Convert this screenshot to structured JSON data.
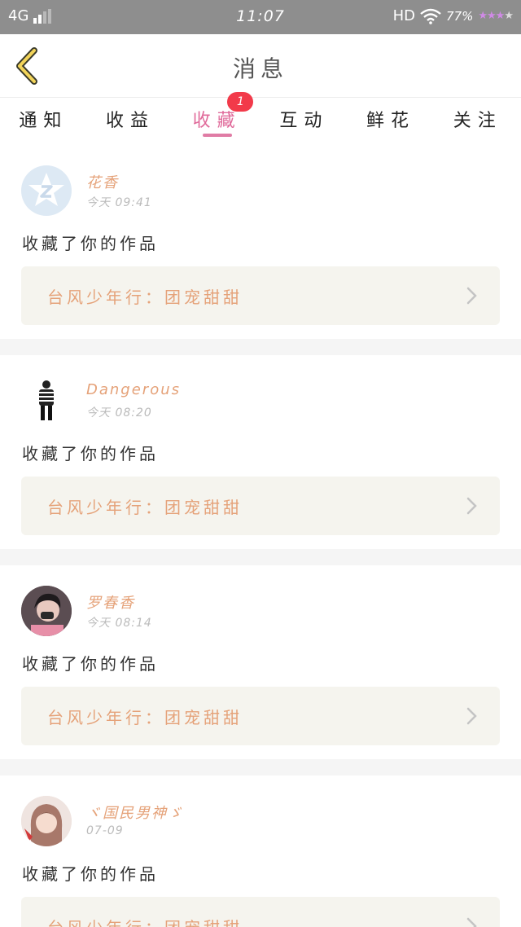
{
  "status_bar": {
    "network": "4G",
    "time": "11:07",
    "hd": "HD",
    "battery": "77%",
    "stars": "★★★"
  },
  "header": {
    "title": "消息"
  },
  "tabs": [
    {
      "label": "通知",
      "active": false
    },
    {
      "label": "收益",
      "active": false
    },
    {
      "label": "收藏",
      "active": true,
      "badge": "1"
    },
    {
      "label": "互动",
      "active": false
    },
    {
      "label": "鲜花",
      "active": false
    },
    {
      "label": "关注",
      "active": false
    }
  ],
  "messages": [
    {
      "user": "花香",
      "time": "今天 09:41",
      "action": "收藏了你的作品",
      "work": "台风少年行：团宠甜甜"
    },
    {
      "user": "Dangerous",
      "time": "今天 08:20",
      "action": "收藏了你的作品",
      "work": "台风少年行：团宠甜甜"
    },
    {
      "user": "罗春香",
      "time": "今天 08:14",
      "action": "收藏了你的作品",
      "work": "台风少年行：团宠甜甜"
    },
    {
      "user": "ヾ国民男神ゞ",
      "time": "07-09",
      "action": "收藏了你的作品",
      "work": "台风少年行：团宠甜甜"
    }
  ],
  "colors": {
    "accent": "#e06a9a",
    "name": "#e5a279",
    "badge": "#f23a4a",
    "card_bg": "#f5f4ee"
  },
  "icons": [
    "back-chevron-icon",
    "chevron-right-icon",
    "wifi-icon",
    "signal-icon"
  ]
}
